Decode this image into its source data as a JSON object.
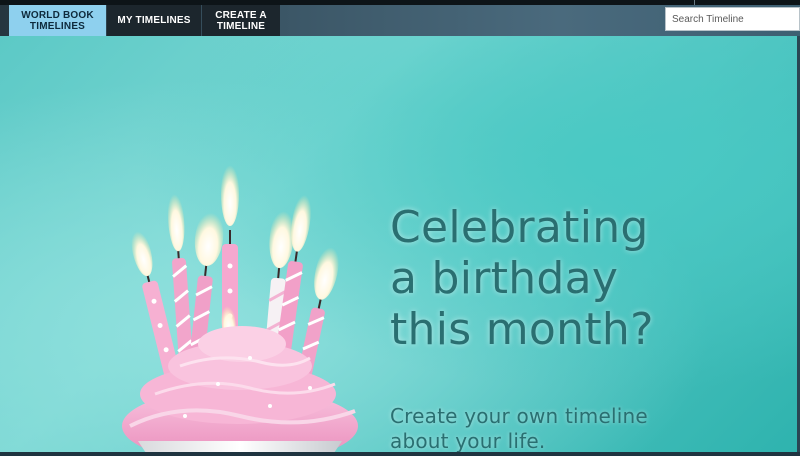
{
  "nav": {
    "tabs": [
      {
        "label_line1": "WORLD BOOK",
        "label_line2": "TIMELINES",
        "active": true
      },
      {
        "label_line1": "MY TIMELINES",
        "label_line2": ""
      },
      {
        "label_line1": "CREATE A",
        "label_line2": "TIMELINE"
      }
    ]
  },
  "search": {
    "placeholder": "Search Timeline",
    "value": ""
  },
  "hero": {
    "headline_line1": "Celebrating",
    "headline_line2": "a birthday",
    "headline_line3": "this month?",
    "subline_line1": "Create your own timeline",
    "subline_line2": "about your life."
  },
  "colors": {
    "active_tab": "#8ed0ee",
    "inactive_tab": "#1c262d",
    "hero_teal": "#5cc9c6",
    "headline": "#2a6f71",
    "frosting": "#f3a9cf"
  }
}
